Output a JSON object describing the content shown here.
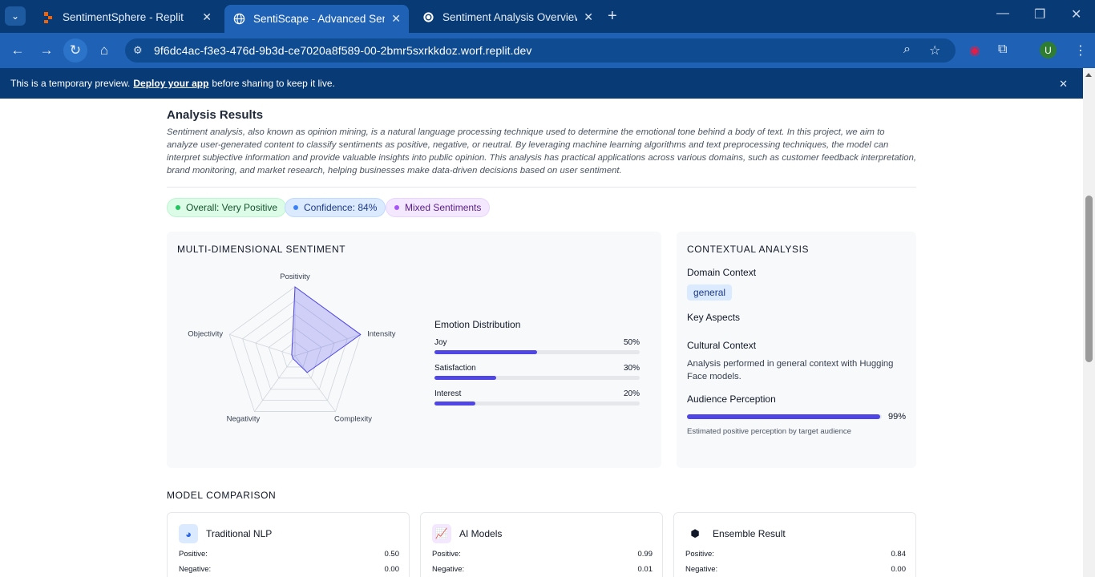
{
  "browser": {
    "tabs": [
      {
        "title": "SentimentSphere - Replit",
        "active": false
      },
      {
        "title": "SentiScape - Advanced Sentime",
        "active": true
      },
      {
        "title": "Sentiment Analysis Overview",
        "active": false
      }
    ],
    "url": "9f6dc4ac-f3e3-476d-9b3d-ce7020a8f589-00-2bmr5sxrkkdoz.worf.replit.dev",
    "profile_initial": "U"
  },
  "banner": {
    "text_before": "This is a temporary preview.",
    "link": "Deploy your app",
    "text_after": "before sharing to keep it live."
  },
  "results": {
    "title": "Analysis Results",
    "description": "Sentiment analysis, also known as opinion mining, is a natural language processing technique used to determine the emotional tone behind a body of text. In this project, we aim to analyze user-generated content to classify sentiments as positive, negative, or neutral. By leveraging machine learning algorithms and text preprocessing techniques, the model can interpret subjective information and provide valuable insights into public opinion. This analysis has practical applications across various domains, such as customer feedback interpretation, brand monitoring, and market research, helping businesses make data-driven decisions based on user sentiment.",
    "badges": [
      {
        "label": "Overall: Very Positive",
        "color": "#22c55e"
      },
      {
        "label": "Confidence: 84%",
        "color": "#3b82f6"
      },
      {
        "label": "Mixed Sentiments",
        "color": "#a855f7"
      }
    ]
  },
  "multi": {
    "title": "MULTI-DIMENSIONAL SENTIMENT",
    "radar_axes": [
      "Positivity",
      "Intensity",
      "Complexity",
      "Negativity",
      "Objectivity"
    ],
    "radar_values": [
      1.0,
      1.0,
      0.3,
      0.0,
      0.0
    ],
    "emotion_title": "Emotion Distribution",
    "emotions": [
      {
        "label": "Joy",
        "pct": "50%",
        "value": 50
      },
      {
        "label": "Satisfaction",
        "pct": "30%",
        "value": 30
      },
      {
        "label": "Interest",
        "pct": "20%",
        "value": 20
      }
    ],
    "accent": "#4f46e5"
  },
  "context": {
    "title": "CONTEXTUAL ANALYSIS",
    "domain_label": "Domain Context",
    "domain_value": "general",
    "aspects_label": "Key Aspects",
    "cultural_label": "Cultural Context",
    "cultural_text": "Analysis performed in general context with Hugging Face models.",
    "audience_label": "Audience Perception",
    "audience_pct": "99%",
    "audience_value": 99,
    "audience_note": "Estimated positive perception by target audience"
  },
  "models": {
    "title": "MODEL COMPARISON",
    "cards": [
      {
        "name": "Traditional NLP",
        "icon": "pie-chart-icon",
        "positive_label": "Positive:",
        "positive": "0.50",
        "negative_label": "Negative:",
        "negative": "0.00"
      },
      {
        "name": "AI Models",
        "icon": "presentation-chart-icon",
        "positive_label": "Positive:",
        "positive": "0.99",
        "negative_label": "Negative:",
        "negative": "0.01"
      },
      {
        "name": "Ensemble Result",
        "icon": "cubes-icon",
        "positive_label": "Positive:",
        "positive": "0.84",
        "negative_label": "Negative:",
        "negative": "0.00"
      }
    ]
  }
}
